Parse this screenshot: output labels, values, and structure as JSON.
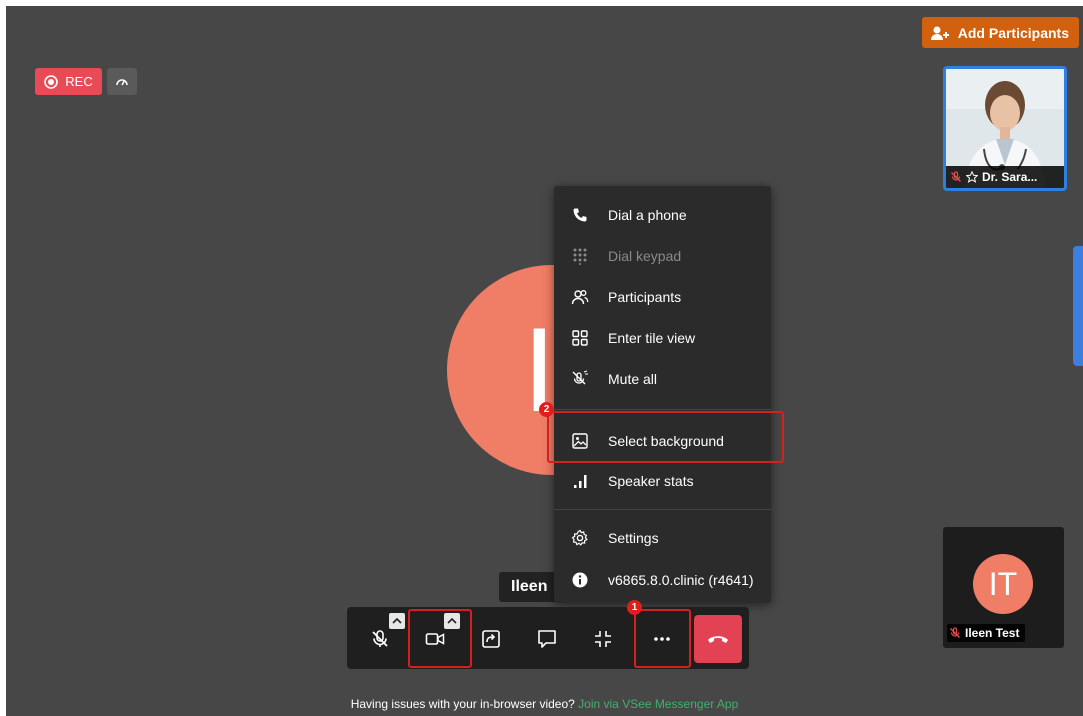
{
  "header": {
    "add_participants_label": "Add Participants"
  },
  "recording": {
    "rec_label": "REC"
  },
  "participants": {
    "doctor_name": "Dr. Sara...",
    "self_name": "Ileen Test",
    "self_initials": "IT",
    "main_initials": "IT",
    "main_name_tag": "Ileen"
  },
  "menu": {
    "items": [
      {
        "label": "Dial a phone",
        "icon": "phone-icon",
        "disabled": false
      },
      {
        "label": "Dial keypad",
        "icon": "keypad-icon",
        "disabled": true
      },
      {
        "label": "Participants",
        "icon": "participants-icon",
        "disabled": false
      },
      {
        "label": "Enter tile view",
        "icon": "tile-view-icon",
        "disabled": false
      },
      {
        "label": "Mute all",
        "icon": "mute-all-icon",
        "disabled": false
      },
      {
        "label": "Select background",
        "icon": "image-icon",
        "disabled": false
      },
      {
        "label": "Speaker stats",
        "icon": "stats-icon",
        "disabled": false
      },
      {
        "label": "Settings",
        "icon": "gear-icon",
        "disabled": false
      },
      {
        "label": "v6865.8.0.clinic (r4641)",
        "icon": "info-icon",
        "disabled": false
      }
    ]
  },
  "annotations": {
    "step1": "1",
    "step2": "2"
  },
  "footer": {
    "text": "Having issues with your in-browser video?",
    "link": "Join via VSee Messenger App"
  },
  "colors": {
    "accent_orange": "#d1600f",
    "rec_red": "#e94b56",
    "avatar_coral": "#f07d66",
    "hangup_red": "#e24253",
    "highlight_red": "#d42020",
    "link_green": "#3db36b"
  }
}
